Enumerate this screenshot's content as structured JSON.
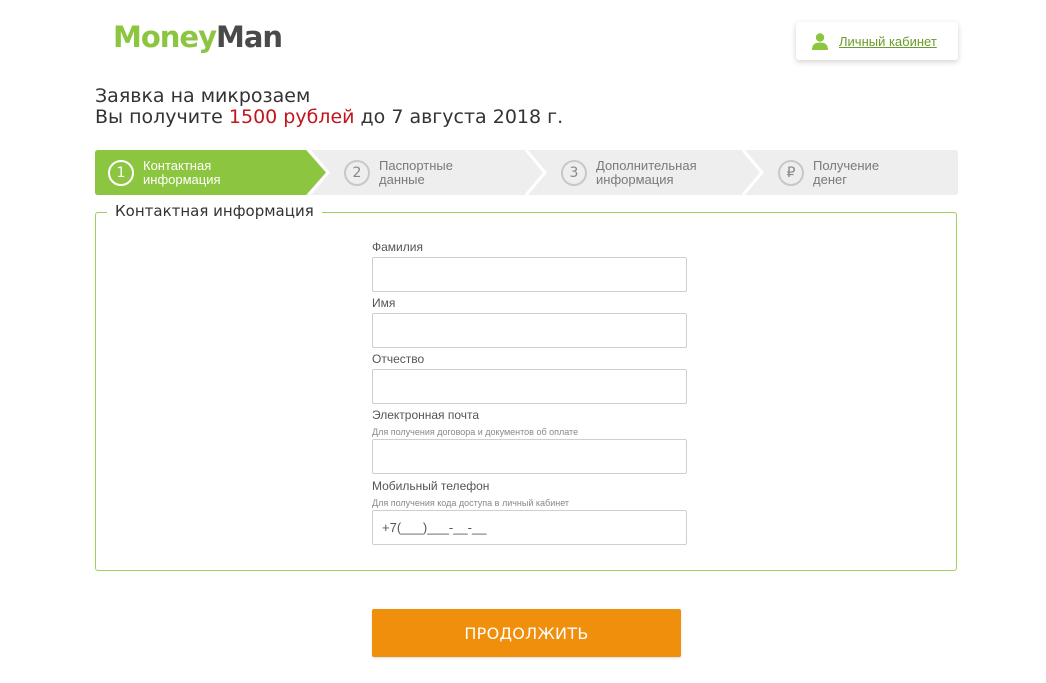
{
  "logo": {
    "part1": "Money",
    "part2": "Man"
  },
  "cabinet": {
    "label": "Личный кабинет",
    "icon": "user-icon"
  },
  "title": {
    "line1": "Заявка на микрозаем",
    "line2_prefix": "Вы получите ",
    "amount": "1500 рублей",
    "line2_suffix": " до 7 августа 2018 г."
  },
  "steps": [
    {
      "number": "1",
      "line1": "Контактная",
      "line2": "информация",
      "active": true
    },
    {
      "number": "2",
      "line1": "Паспортные",
      "line2": "данные",
      "active": false
    },
    {
      "number": "3",
      "line1": "Дополнительная",
      "line2": "информация",
      "active": false
    },
    {
      "number": "₽",
      "line1": "Получение",
      "line2": "денег",
      "active": false
    }
  ],
  "section": {
    "legend": "Контактная информация"
  },
  "fields": {
    "last_name": {
      "label": "Фамилия",
      "value": ""
    },
    "first_name": {
      "label": "Имя",
      "value": ""
    },
    "middle_name": {
      "label": "Отчество",
      "value": ""
    },
    "email": {
      "label": "Электронная почта",
      "hint": "Для получения договора и документов об оплате",
      "value": ""
    },
    "phone": {
      "label": "Мобильный телефон",
      "hint": "Для получения кода доступа в личный кабинет",
      "placeholder": "+7(___)___-__-__"
    }
  },
  "submit": {
    "label": "ПРОДОЛЖИТЬ"
  },
  "colors": {
    "brand_green": "#8cc53f",
    "accent_orange": "#ef8f0b",
    "amount_red": "#c0161c"
  }
}
